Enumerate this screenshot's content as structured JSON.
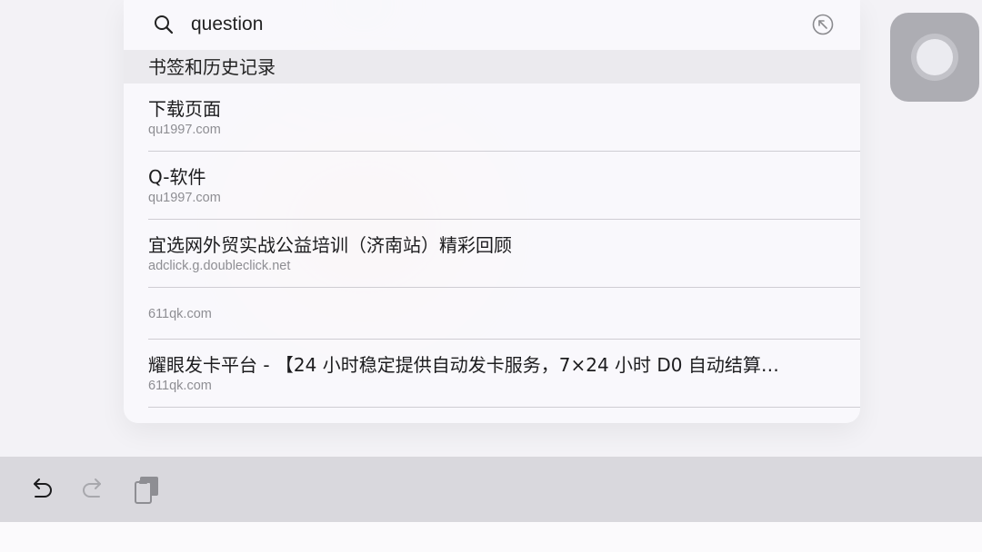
{
  "search": {
    "value": "question"
  },
  "section_header": "书签和历史记录",
  "results": [
    {
      "title": "下载页面",
      "url": "qu1997.com"
    },
    {
      "title": "Q-软件",
      "url": "qu1997.com"
    },
    {
      "title": "宜选网外贸实战公益培训（济南站）精彩回顾",
      "url": "adclick.g.doubleclick.net"
    },
    {
      "title": "",
      "url": "611qk.com"
    },
    {
      "title": "耀眼发卡平台 - 【24 小时稳定提供自动发卡服务，7×24 小时 D0 自动结算…",
      "url": "611qk.com"
    }
  ],
  "icons": {
    "search": "magnifier-icon",
    "fill_query": "arrow-up-left-circle-icon",
    "assistive": "assistive-touch-icon",
    "undo": "undo-icon",
    "redo": "redo-icon",
    "paste": "clipboard-icon"
  },
  "colors": {
    "primary_text": "#1c1c1e",
    "secondary_text": "#8e8e93",
    "section_bg": "#ebeaee",
    "toolbar_bg": "#d9d8dd"
  }
}
